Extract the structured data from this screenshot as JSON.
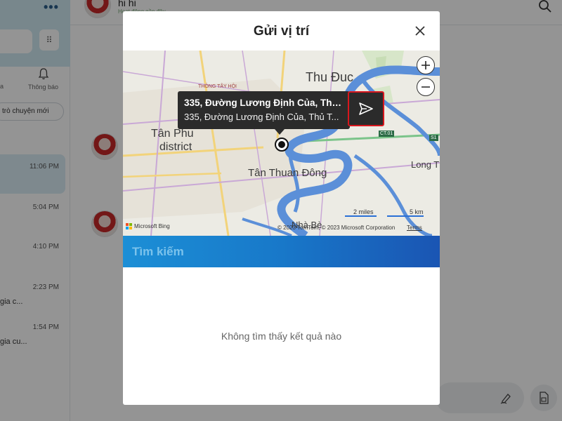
{
  "sidebar": {
    "more_label": "•••",
    "tab_left_label": "a",
    "notifications_label": "Thông báo",
    "new_chat_label": "trò chuyện mới",
    "conversations": [
      {
        "time": "11:06 PM",
        "preview": ""
      },
      {
        "time": "5:04 PM",
        "preview": ""
      },
      {
        "time": "4:10 PM",
        "preview": ""
      },
      {
        "time": "2:23 PM",
        "preview": "gia c..."
      },
      {
        "time": "1:54 PM",
        "preview": "gia cu..."
      }
    ]
  },
  "chat": {
    "contact_name": "hi hi",
    "contact_status": "Hoạt động gần đây"
  },
  "modal": {
    "title": "Gửi vị trí",
    "map": {
      "place_labels": {
        "thu_duc": "Thu Đuc",
        "tan_phu": "Tân Phu",
        "district": "district",
        "tan_thuan_dong": "Tân Thuan Đông",
        "long_t": "Long T",
        "nha_be": "Nhà Bè",
        "thong_tay_hoi": "THÔNG TÂY HỘI",
        "ct01": "CT.01",
        "s1": "S1"
      },
      "callout_title": "335, Đường Lương Định Của, Thủ ...",
      "callout_subtitle": "335, Đường Lương Định Của, Thủ T...",
      "scale_miles": "2 miles",
      "scale_km": "5 km",
      "attribution": "Microsoft Bing",
      "copyright": "© 2023 TomTom, © 2023 Microsoft Corporation",
      "terms": "Terms"
    },
    "search_placeholder": "Tìm kiếm",
    "search_value": "",
    "empty_text": "Không tìm thấy kết quả nào"
  },
  "colors": {
    "search_gradient_start": "#1c8fd6",
    "search_gradient_end": "#1a55b3",
    "send_highlight": "#d8161d",
    "callout_bg": "#2b2b2b",
    "river": "#5b8fd8"
  }
}
